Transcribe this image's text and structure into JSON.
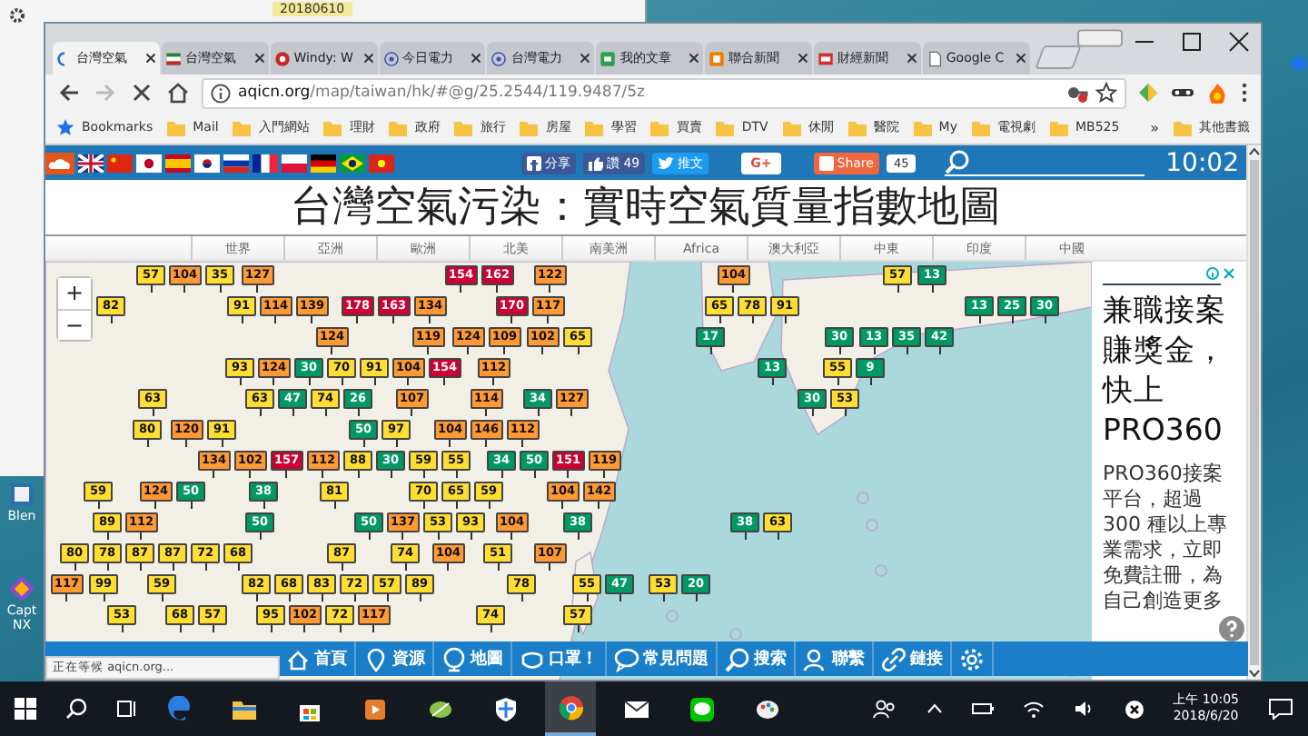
{
  "desktop": {
    "background_window_text": "20180610",
    "icons": [
      {
        "label": "Blen"
      },
      {
        "label": "Capt NX"
      }
    ]
  },
  "browser": {
    "tabs": [
      {
        "title": "台灣空氣",
        "selected": true,
        "kind": "loading"
      },
      {
        "title": "台灣空氣",
        "selected": false,
        "kind": "flag"
      },
      {
        "title": "Windy: W",
        "selected": false,
        "kind": "windy"
      },
      {
        "title": "今日電力",
        "selected": false,
        "kind": "power"
      },
      {
        "title": "台灣電力",
        "selected": false,
        "kind": "power"
      },
      {
        "title": "我的文章",
        "selected": false,
        "kind": "green"
      },
      {
        "title": "聯合新聞",
        "selected": false,
        "kind": "orange"
      },
      {
        "title": "財經新聞",
        "selected": false,
        "kind": "red"
      },
      {
        "title": "Google C",
        "selected": false,
        "kind": "page"
      }
    ],
    "url_host": "aqicn.org",
    "url_path": "/map/taiwan/hk/#@g/25.2544/119.9487/5z",
    "bookmarks": [
      {
        "label": "Bookmarks",
        "kind": "star"
      },
      {
        "label": "Mail",
        "kind": "folder"
      },
      {
        "label": "入門網站",
        "kind": "folder"
      },
      {
        "label": "理財",
        "kind": "folder"
      },
      {
        "label": "政府",
        "kind": "folder"
      },
      {
        "label": "旅行",
        "kind": "folder"
      },
      {
        "label": "房屋",
        "kind": "folder"
      },
      {
        "label": "學習",
        "kind": "folder"
      },
      {
        "label": "買賣",
        "kind": "folder"
      },
      {
        "label": "DTV",
        "kind": "folder"
      },
      {
        "label": "休閒",
        "kind": "folder"
      },
      {
        "label": "醫院",
        "kind": "folder"
      },
      {
        "label": "My",
        "kind": "folder"
      },
      {
        "label": "電視劇",
        "kind": "folder"
      },
      {
        "label": "MB525",
        "kind": "folder"
      }
    ],
    "overflow": "»",
    "other_bookmarks": "其他書籤"
  },
  "site": {
    "share": [
      {
        "label": "分享",
        "kind": "facebook"
      },
      {
        "label": "讚 49",
        "kind": "like"
      },
      {
        "label": "推文",
        "kind": "twitter"
      },
      {
        "label": "G+",
        "kind": "gplus"
      },
      {
        "label": "Share",
        "kind": "share"
      }
    ],
    "share_count": "45",
    "clock": "10:02",
    "title": "台灣空氣污染：實時空氣質量指數地圖",
    "regions": [
      "世界",
      "亞洲",
      "歐洲",
      "北美",
      "南美洲",
      "Africa",
      "澳大利亞",
      "中東",
      "印度",
      "中國"
    ],
    "zoom_in": "+",
    "zoom_out": "−",
    "markers": [
      {
        "value": "57",
        "color": "#ffde33"
      },
      {
        "value": "104",
        "color": "#ff9933"
      },
      {
        "value": "35",
        "color": "#ffde33"
      },
      {
        "value": "127",
        "color": "#ff9933"
      },
      {
        "value": "154",
        "color": "#cc0033"
      },
      {
        "value": "162",
        "color": "#cc0033"
      },
      {
        "value": "122",
        "color": "#ff9933"
      },
      {
        "value": "104",
        "color": "#ff9933"
      },
      {
        "value": "57",
        "color": "#ffde33"
      },
      {
        "value": "13",
        "color": "#009966"
      },
      {
        "value": "82",
        "color": "#ffde33"
      },
      {
        "value": "91",
        "color": "#ffde33"
      },
      {
        "value": "114",
        "color": "#ff9933"
      },
      {
        "value": "139",
        "color": "#ff9933"
      },
      {
        "value": "178",
        "color": "#cc0033"
      },
      {
        "value": "163",
        "color": "#cc0033"
      },
      {
        "value": "134",
        "color": "#ff9933"
      },
      {
        "value": "170",
        "color": "#cc0033"
      },
      {
        "value": "117",
        "color": "#ff9933"
      },
      {
        "value": "65",
        "color": "#ffde33"
      },
      {
        "value": "78",
        "color": "#ffde33"
      },
      {
        "value": "91",
        "color": "#ffde33"
      },
      {
        "value": "13",
        "color": "#009966"
      },
      {
        "value": "25",
        "color": "#009966"
      },
      {
        "value": "30",
        "color": "#009966"
      },
      {
        "value": "124",
        "color": "#ff9933"
      },
      {
        "value": "119",
        "color": "#ff9933"
      },
      {
        "value": "124",
        "color": "#ff9933"
      },
      {
        "value": "109",
        "color": "#ff9933"
      },
      {
        "value": "102",
        "color": "#ff9933"
      },
      {
        "value": "65",
        "color": "#ffde33"
      },
      {
        "value": "17",
        "color": "#009966"
      },
      {
        "value": "30",
        "color": "#009966"
      },
      {
        "value": "13",
        "color": "#009966"
      },
      {
        "value": "35",
        "color": "#009966"
      },
      {
        "value": "42",
        "color": "#009966"
      },
      {
        "value": "93",
        "color": "#ffde33"
      },
      {
        "value": "124",
        "color": "#ff9933"
      },
      {
        "value": "30",
        "color": "#009966"
      },
      {
        "value": "70",
        "color": "#ffde33"
      },
      {
        "value": "91",
        "color": "#ffde33"
      },
      {
        "value": "104",
        "color": "#ff9933"
      },
      {
        "value": "154",
        "color": "#cc0033"
      },
      {
        "value": "112",
        "color": "#ff9933"
      },
      {
        "value": "13",
        "color": "#009966"
      },
      {
        "value": "55",
        "color": "#ffde33"
      },
      {
        "value": "9",
        "color": "#009966"
      },
      {
        "value": "63",
        "color": "#ffde33"
      },
      {
        "value": "63",
        "color": "#ffde33"
      },
      {
        "value": "47",
        "color": "#009966"
      },
      {
        "value": "74",
        "color": "#ffde33"
      },
      {
        "value": "26",
        "color": "#009966"
      },
      {
        "value": "107",
        "color": "#ff9933"
      },
      {
        "value": "114",
        "color": "#ff9933"
      },
      {
        "value": "34",
        "color": "#009966"
      },
      {
        "value": "127",
        "color": "#ff9933"
      },
      {
        "value": "30",
        "color": "#009966"
      },
      {
        "value": "53",
        "color": "#ffde33"
      },
      {
        "value": "80",
        "color": "#ffde33"
      },
      {
        "value": "120",
        "color": "#ff9933"
      },
      {
        "value": "91",
        "color": "#ffde33"
      },
      {
        "value": "50",
        "color": "#009966"
      },
      {
        "value": "97",
        "color": "#ffde33"
      },
      {
        "value": "104",
        "color": "#ff9933"
      },
      {
        "value": "146",
        "color": "#ff9933"
      },
      {
        "value": "112",
        "color": "#ff9933"
      },
      {
        "value": "134",
        "color": "#ff9933"
      },
      {
        "value": "102",
        "color": "#ff9933"
      },
      {
        "value": "157",
        "color": "#cc0033"
      },
      {
        "value": "112",
        "color": "#ff9933"
      },
      {
        "value": "88",
        "color": "#ffde33"
      },
      {
        "value": "30",
        "color": "#009966"
      },
      {
        "value": "59",
        "color": "#ffde33"
      },
      {
        "value": "55",
        "color": "#ffde33"
      },
      {
        "value": "34",
        "color": "#009966"
      },
      {
        "value": "50",
        "color": "#009966"
      },
      {
        "value": "151",
        "color": "#cc0033"
      },
      {
        "value": "119",
        "color": "#ff9933"
      },
      {
        "value": "59",
        "color": "#ffde33"
      },
      {
        "value": "124",
        "color": "#ff9933"
      },
      {
        "value": "50",
        "color": "#009966"
      },
      {
        "value": "38",
        "color": "#009966"
      },
      {
        "value": "81",
        "color": "#ffde33"
      },
      {
        "value": "70",
        "color": "#ffde33"
      },
      {
        "value": "65",
        "color": "#ffde33"
      },
      {
        "value": "59",
        "color": "#ffde33"
      },
      {
        "value": "104",
        "color": "#ff9933"
      },
      {
        "value": "142",
        "color": "#ff9933"
      },
      {
        "value": "89",
        "color": "#ffde33"
      },
      {
        "value": "112",
        "color": "#ff9933"
      },
      {
        "value": "50",
        "color": "#009966"
      },
      {
        "value": "50",
        "color": "#009966"
      },
      {
        "value": "137",
        "color": "#ff9933"
      },
      {
        "value": "53",
        "color": "#ffde33"
      },
      {
        "value": "93",
        "color": "#ffde33"
      },
      {
        "value": "104",
        "color": "#ff9933"
      },
      {
        "value": "38",
        "color": "#009966"
      },
      {
        "value": "38",
        "color": "#009966"
      },
      {
        "value": "63",
        "color": "#ffde33"
      },
      {
        "value": "80",
        "color": "#ffde33"
      },
      {
        "value": "78",
        "color": "#ffde33"
      },
      {
        "value": "87",
        "color": "#ffde33"
      },
      {
        "value": "87",
        "color": "#ffde33"
      },
      {
        "value": "72",
        "color": "#ffde33"
      },
      {
        "value": "68",
        "color": "#ffde33"
      },
      {
        "value": "87",
        "color": "#ffde33"
      },
      {
        "value": "74",
        "color": "#ffde33"
      },
      {
        "value": "104",
        "color": "#ff9933"
      },
      {
        "value": "51",
        "color": "#ffde33"
      },
      {
        "value": "107",
        "color": "#ff9933"
      },
      {
        "value": "117",
        "color": "#ff9933"
      },
      {
        "value": "99",
        "color": "#ffde33"
      },
      {
        "value": "59",
        "color": "#ffde33"
      },
      {
        "value": "82",
        "color": "#ffde33"
      },
      {
        "value": "68",
        "color": "#ffde33"
      },
      {
        "value": "83",
        "color": "#ffde33"
      },
      {
        "value": "72",
        "color": "#ffde33"
      },
      {
        "value": "57",
        "color": "#ffde33"
      },
      {
        "value": "89",
        "color": "#ffde33"
      },
      {
        "value": "78",
        "color": "#ffde33"
      },
      {
        "value": "55",
        "color": "#ffde33"
      },
      {
        "value": "47",
        "color": "#009966"
      },
      {
        "value": "53",
        "color": "#ffde33"
      },
      {
        "value": "20",
        "color": "#009966"
      },
      {
        "value": "53",
        "color": "#ffde33"
      },
      {
        "value": "68",
        "color": "#ffde33"
      },
      {
        "value": "57",
        "color": "#ffde33"
      },
      {
        "value": "95",
        "color": "#ffde33"
      },
      {
        "value": "102",
        "color": "#ff9933"
      },
      {
        "value": "72",
        "color": "#ffde33"
      },
      {
        "value": "117",
        "color": "#ff9933"
      },
      {
        "value": "74",
        "color": "#ffde33"
      },
      {
        "value": "57",
        "color": "#ffde33"
      }
    ],
    "ad": {
      "headline": "兼職接案賺獎金，快上PRO360",
      "body": "PRO360接案平台，超過300 種以上專業需求，立即免費註冊，為自己創造更多"
    },
    "bottom_nav": [
      {
        "label": "首頁",
        "kind": "home"
      },
      {
        "label": "資源",
        "kind": "pin"
      },
      {
        "label": "地圖",
        "kind": "globe"
      },
      {
        "label": "口罩！",
        "kind": "mask"
      },
      {
        "label": "常見問題",
        "kind": "faq"
      },
      {
        "label": "搜索",
        "kind": "search"
      },
      {
        "label": "聯繫",
        "kind": "contact"
      },
      {
        "label": "鏈接",
        "kind": "link"
      },
      {
        "kind": "settings"
      }
    ]
  },
  "status_text": "正在等候 aqicn.org...",
  "taskbar": {
    "apps": [
      {
        "kind": "edge",
        "selected": false
      },
      {
        "kind": "explorer",
        "selected": false
      },
      {
        "kind": "store",
        "selected": false
      },
      {
        "kind": "media",
        "selected": false
      },
      {
        "kind": "leaf",
        "selected": false
      },
      {
        "kind": "shield",
        "selected": false
      },
      {
        "kind": "chrome",
        "selected": true
      },
      {
        "kind": "mail",
        "selected": false
      },
      {
        "kind": "line",
        "selected": false
      },
      {
        "kind": "paint",
        "selected": false
      }
    ],
    "time": "上午 10:05",
    "date": "2018/6/20"
  }
}
